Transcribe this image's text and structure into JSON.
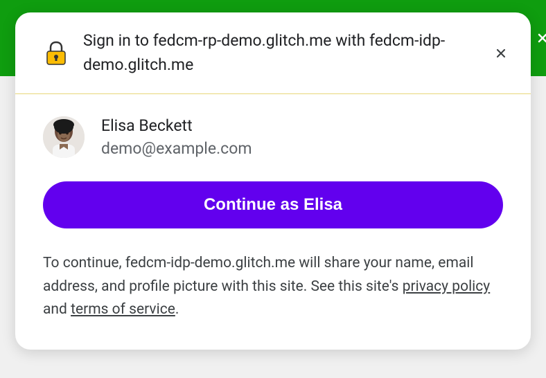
{
  "header": {
    "title": "Sign in to fedcm-rp-demo.glitch.me with fedcm-idp-demo.glitch.me"
  },
  "account": {
    "name": "Elisa Beckett",
    "email": "demo@example.com"
  },
  "actions": {
    "continue_label": "Continue as Elisa"
  },
  "disclosure": {
    "pre": "To continue, fedcm-idp-demo.glitch.me will share your name, email address, and profile picture with this site. See this site's ",
    "privacy_label": "privacy policy",
    "mid": " and ",
    "terms_label": "terms of service",
    "post": "."
  }
}
